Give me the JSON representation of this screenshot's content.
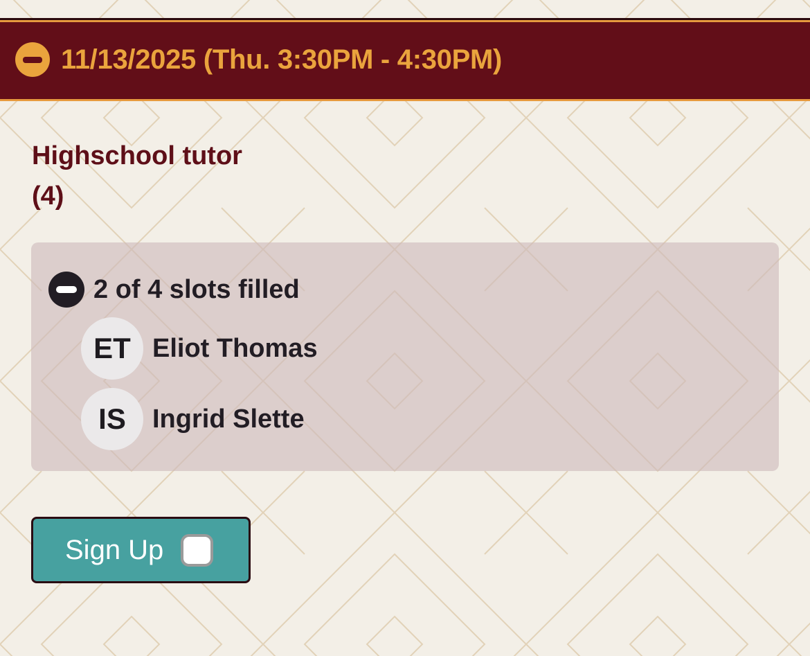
{
  "header": {
    "title": "11/13/2025 (Thu. 3:30PM - 4:30PM)",
    "icon": "minus-circle-icon",
    "colors": {
      "background": "#620e18",
      "accent": "#eaa43d"
    }
  },
  "slot": {
    "title_line1": "Highschool tutor",
    "title_line2": "(4)"
  },
  "slots_panel": {
    "summary": "2 of 4 slots filled",
    "filled": 2,
    "total": 4,
    "icon": "minus-circle-icon",
    "people": [
      {
        "initials": "ET",
        "name": "Eliot Thomas"
      },
      {
        "initials": "IS",
        "name": "Ingrid Slette"
      }
    ]
  },
  "signup_button": {
    "label": "Sign Up",
    "checked": false,
    "color": "#47a1a0"
  }
}
